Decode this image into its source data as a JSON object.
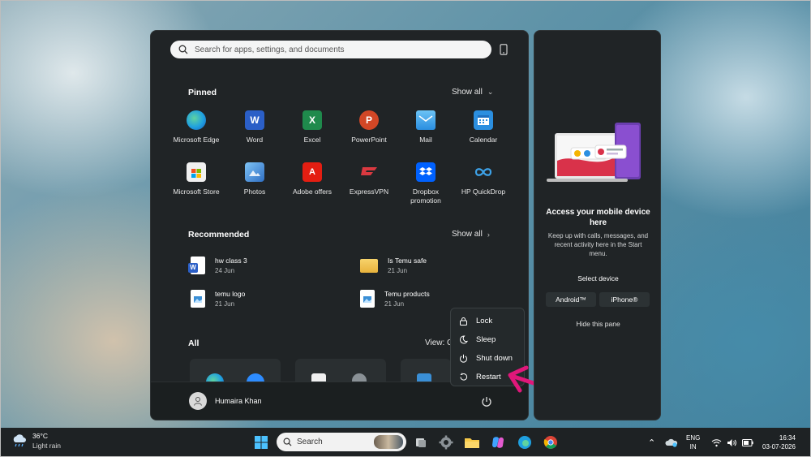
{
  "search": {
    "placeholder": "Search for apps, settings, and documents"
  },
  "pinned": {
    "title": "Pinned",
    "show_all": "Show all",
    "apps": [
      {
        "label": "Microsoft Edge",
        "icon": "edge-icon",
        "color": "#1fa0e0"
      },
      {
        "label": "Word",
        "icon": "word-icon",
        "color": "#2b5fc7"
      },
      {
        "label": "Excel",
        "icon": "excel-icon",
        "color": "#1f8a4c"
      },
      {
        "label": "PowerPoint",
        "icon": "powerpoint-icon",
        "color": "#d24726"
      },
      {
        "label": "Mail",
        "icon": "mail-icon",
        "color": "#2a8ee0"
      },
      {
        "label": "Calendar",
        "icon": "calendar-icon",
        "color": "#2b8fe0"
      },
      {
        "label": "Microsoft Store",
        "icon": "store-icon",
        "color": "#f0f0f0"
      },
      {
        "label": "Photos",
        "icon": "photos-icon",
        "color": "#3a8fd6"
      },
      {
        "label": "Adobe offers",
        "icon": "adobe-icon",
        "color": "#e41e12"
      },
      {
        "label": "ExpressVPN",
        "icon": "expressvpn-icon",
        "color": "#da3940"
      },
      {
        "label": "Dropbox promotion",
        "icon": "dropbox-icon",
        "color": "#0061fe"
      },
      {
        "label": "HP QuickDrop",
        "icon": "hp-quickdrop-icon",
        "color": "#3da2e8"
      }
    ]
  },
  "recommended": {
    "title": "Recommended",
    "show_all": "Show all",
    "items": [
      {
        "name": "hw class 3",
        "date": "24 Jun",
        "icon": "word-doc-icon"
      },
      {
        "name": "Is Temu safe",
        "date": "21 Jun",
        "icon": "folder-icon"
      },
      {
        "name": "temu logo",
        "date": "21 Jun",
        "icon": "image-file-icon"
      },
      {
        "name": "Temu products",
        "date": "21 Jun",
        "icon": "image-file-icon"
      }
    ]
  },
  "all": {
    "title": "All",
    "view_label": "View: C"
  },
  "user": {
    "name": "Humaira Khan"
  },
  "power_menu": {
    "items": [
      {
        "label": "Lock",
        "icon": "lock-icon"
      },
      {
        "label": "Sleep",
        "icon": "sleep-icon"
      },
      {
        "label": "Shut down",
        "icon": "shutdown-icon"
      },
      {
        "label": "Restart",
        "icon": "restart-icon"
      }
    ]
  },
  "side_panel": {
    "title": "Access your mobile device here",
    "description": "Keep up with calls, messages, and recent activity here in the Start menu.",
    "select_label": "Select device",
    "android_label": "Android™",
    "iphone_label": "iPhone®",
    "hide_label": "Hide this pane"
  },
  "taskbar": {
    "weather_temp": "36°C",
    "weather_desc": "Light rain",
    "search_label": "Search",
    "lang_top": "ENG",
    "lang_bottom": "IN",
    "time": "16:34",
    "date": "03-07-2026"
  },
  "colors": {
    "annotation_arrow": "#e0177a",
    "panel_bg": "#202426"
  }
}
